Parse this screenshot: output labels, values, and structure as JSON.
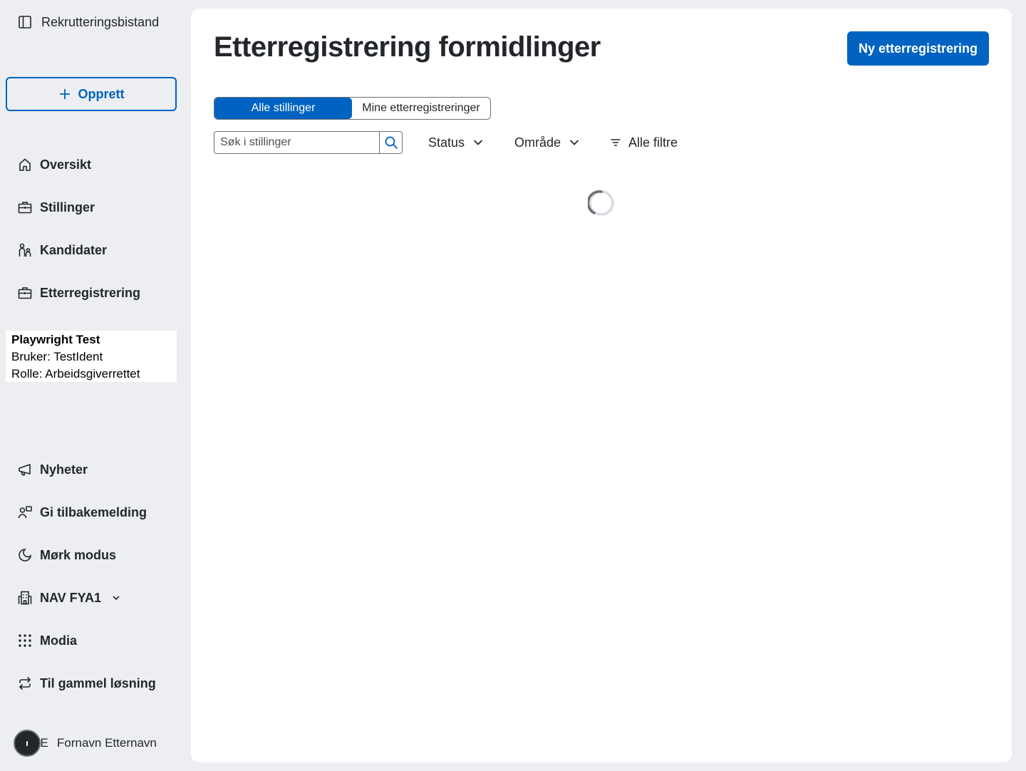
{
  "sidebar": {
    "app_title": "Rekrutteringsbistand",
    "create_label": "Opprett",
    "nav": [
      {
        "label": "Oversikt",
        "icon": "home-icon"
      },
      {
        "label": "Stillinger",
        "icon": "briefcase-icon"
      },
      {
        "label": "Kandidater",
        "icon": "person-group-icon"
      },
      {
        "label": "Etterregistrering",
        "icon": "briefcase-icon"
      }
    ],
    "user": {
      "name": "Playwright Test",
      "bruker": "Bruker: TestIdent",
      "rolle": "Rolle: Arbeidsgiverrettet"
    },
    "bottom_nav": [
      {
        "label": "Nyheter",
        "icon": "megaphone-icon"
      },
      {
        "label": "Gi tilbakemelding",
        "icon": "feedback-icon"
      },
      {
        "label": "Mørk modus",
        "icon": "moon-icon"
      },
      {
        "label": "NAV FYA1",
        "icon": "building-icon"
      },
      {
        "label": "Modia",
        "icon": "grid-icon"
      },
      {
        "label": "Til gammel løsning",
        "icon": "arrows-circle-icon"
      }
    ],
    "profile": {
      "initials": "FE",
      "name": "Fornavn Etternavn"
    }
  },
  "main": {
    "title": "Etterregistrering formidlinger",
    "new_button": "Ny etterregistrering",
    "tabs": [
      {
        "label": "Alle stillinger",
        "active": true
      },
      {
        "label": "Mine etterregistreringer",
        "active": false
      }
    ],
    "search": {
      "placeholder": "Søk i stillinger",
      "value": ""
    },
    "filters": {
      "status": "Status",
      "area": "Område",
      "all": "Alle filtre"
    }
  },
  "colors": {
    "accent": "#0063c1",
    "background": "#eceef1",
    "panel": "#ffffff",
    "text": "#23262a"
  }
}
